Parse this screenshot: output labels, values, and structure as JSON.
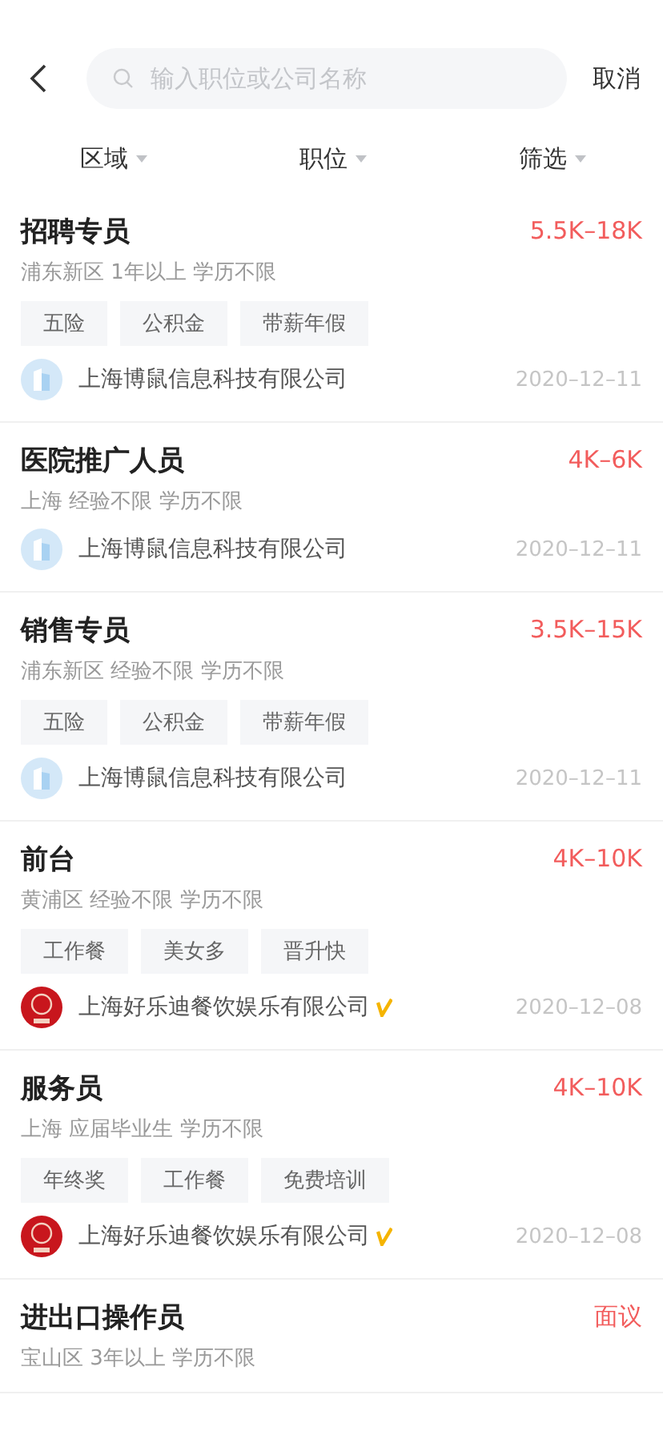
{
  "search": {
    "placeholder": "输入职位或公司名称",
    "cancel": "取消"
  },
  "filters": [
    {
      "label": "区域"
    },
    {
      "label": "职位"
    },
    {
      "label": "筛选"
    }
  ],
  "jobs": [
    {
      "title": "招聘专员",
      "salary": "5.5K–18K",
      "meta": "浦东新区 1年以上 学历不限",
      "tags": [
        "五险",
        "公积金",
        "带薪年假"
      ],
      "company": "上海博鼠信息科技有限公司",
      "kind": "building",
      "verified": false,
      "date": "2020–12–11"
    },
    {
      "title": "医院推广人员",
      "salary": "4K–6K",
      "meta": "上海 经验不限 学历不限",
      "company": "上海博鼠信息科技有限公司",
      "kind": "building",
      "verified": false,
      "date": "2020–12–11"
    },
    {
      "title": "销售专员",
      "salary": "3.5K–15K",
      "meta": "浦东新区 经验不限 学历不限",
      "tags": [
        "五险",
        "公积金",
        "带薪年假"
      ],
      "company": "上海博鼠信息科技有限公司",
      "kind": "building",
      "verified": false,
      "date": "2020–12–11"
    },
    {
      "title": "前台",
      "salary": "4K–10K",
      "meta": "黄浦区 经验不限 学历不限",
      "tags": [
        "工作餐",
        "美女多",
        "晋升快"
      ],
      "company": "上海好乐迪餐饮娱乐有限公司",
      "kind": "emblem",
      "verified": true,
      "date": "2020–12–08"
    },
    {
      "title": "服务员",
      "salary": "4K–10K",
      "meta": "上海 应届毕业生 学历不限",
      "tags": [
        "年终奖",
        "工作餐",
        "免费培训"
      ],
      "company": "上海好乐迪餐饮娱乐有限公司",
      "kind": "emblem",
      "verified": true,
      "date": "2020–12–08"
    },
    {
      "title": "进出口操作员",
      "salary": "面议",
      "meta": "宝山区 3年以上 学历不限"
    }
  ]
}
